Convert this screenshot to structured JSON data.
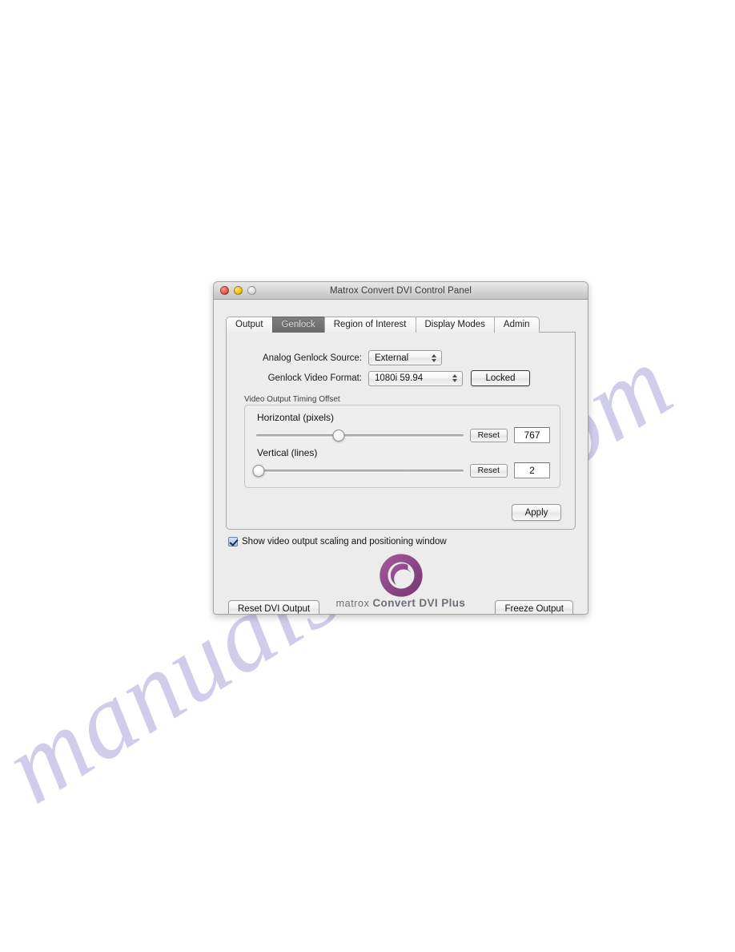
{
  "page": {
    "watermark": "manualshive.com"
  },
  "window": {
    "title": "Matrox Convert DVI Control Panel",
    "traffic_lights": {
      "close": "close-button",
      "minimize": "minimize-button",
      "zoom": "zoom-button"
    }
  },
  "tabs": [
    {
      "label": "Output",
      "selected": false
    },
    {
      "label": "Genlock",
      "selected": true
    },
    {
      "label": "Region of Interest",
      "selected": false
    },
    {
      "label": "Display Modes",
      "selected": false
    },
    {
      "label": "Admin",
      "selected": false
    }
  ],
  "genlock": {
    "source_label": "Analog Genlock Source:",
    "source_value": "External",
    "format_label": "Genlock Video Format:",
    "format_value": "1080i 59.94",
    "status_label": "Locked"
  },
  "timing_offset": {
    "group_label": "Video Output Timing Offset",
    "horizontal": {
      "title": "Horizontal (pixels)",
      "reset_label": "Reset",
      "value": "767",
      "knob_percent": 40
    },
    "vertical": {
      "title": "Vertical (lines)",
      "reset_label": "Reset",
      "value": "2",
      "knob_percent": 1
    }
  },
  "actions": {
    "apply_label": "Apply",
    "reset_dvi_output_label": "Reset DVI Output",
    "freeze_output_label": "Freeze Output"
  },
  "options": {
    "show_window_label": "Show video output scaling and positioning window",
    "show_window_checked": true
  },
  "brand": {
    "company": "matrox",
    "product": "Convert DVI Plus",
    "logo_color": "#8e4a86"
  }
}
